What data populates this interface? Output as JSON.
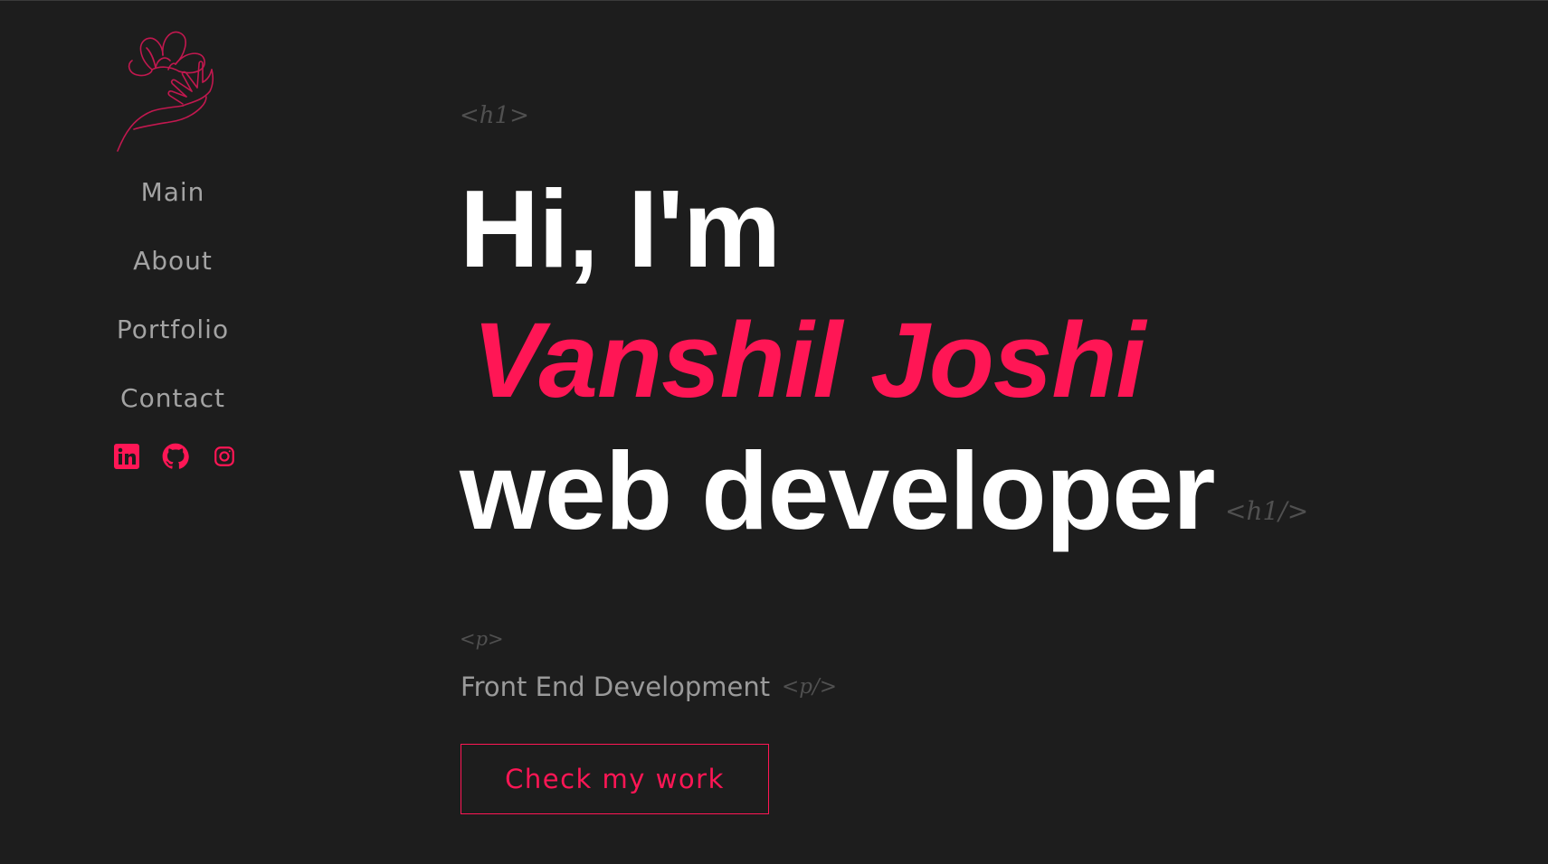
{
  "sidebar": {
    "logo_icon": "flower-hand-icon",
    "nav": [
      {
        "label": "Main"
      },
      {
        "label": "About"
      },
      {
        "label": "Portfolio"
      },
      {
        "label": "Contact"
      }
    ],
    "socials": [
      {
        "icon": "linkedin-icon"
      },
      {
        "icon": "github-icon"
      },
      {
        "icon": "instagram-icon"
      }
    ]
  },
  "hero": {
    "tag_open": "<h1>",
    "line1": "Hi, I'm",
    "name": "Vanshil Joshi",
    "line3": "web developer",
    "tag_close": "<h1/>",
    "p_open": "<p>",
    "subtitle": "Front End Development",
    "p_close": "<p/>",
    "cta_label": "Check my work"
  },
  "colors": {
    "background": "#1d1d1d",
    "accent": "#ff1655",
    "nav_text": "#a3a3a3",
    "tag_text": "#505050"
  }
}
